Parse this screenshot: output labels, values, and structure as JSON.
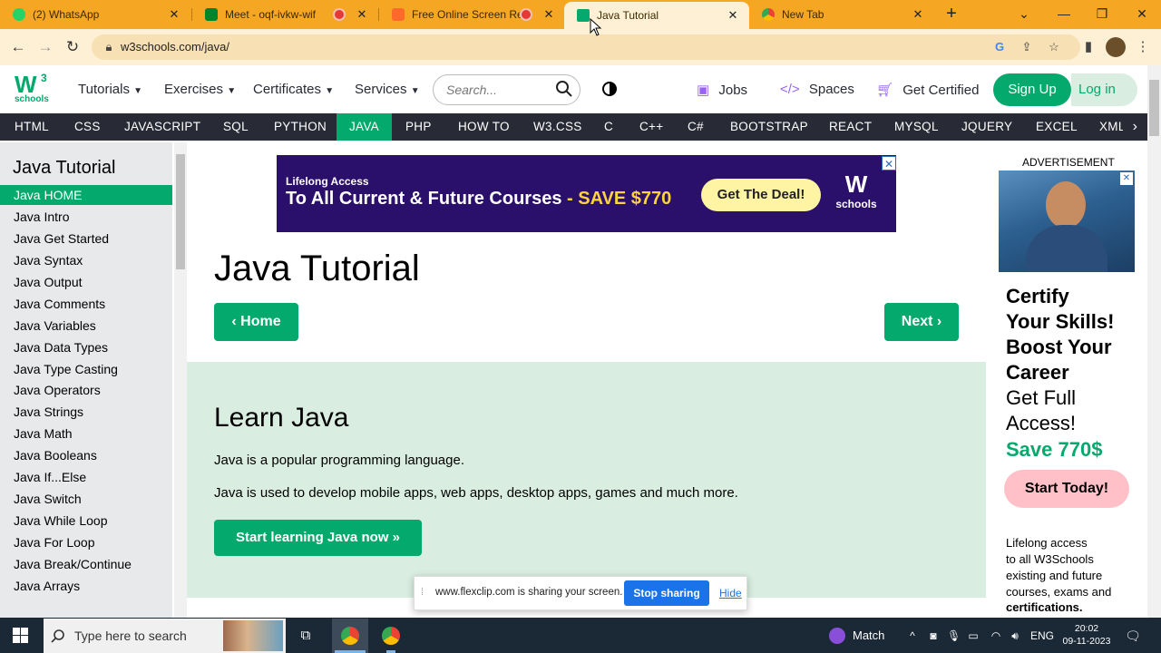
{
  "browser": {
    "tabs": [
      {
        "title": "(2) WhatsApp",
        "icon": "whatsapp-icon"
      },
      {
        "title": "Meet - oqf-ivkw-wif",
        "icon": "meet-icon",
        "recording": true
      },
      {
        "title": "Free Online Screen Reco",
        "icon": "flexclip-icon",
        "recording": true
      },
      {
        "title": "Java Tutorial",
        "icon": "w3schools-icon",
        "active": true
      },
      {
        "title": "New Tab",
        "icon": "chrome-icon"
      }
    ],
    "new_tab": "+",
    "url": "w3schools.com/java/"
  },
  "header": {
    "logo_main": "W",
    "logo_sup": "3",
    "logo_sub": "schools",
    "menus": [
      "Tutorials",
      "Exercises",
      "Certificates",
      "Services"
    ],
    "search_placeholder": "Search...",
    "links": [
      "Jobs",
      "Spaces",
      "Get Certified"
    ],
    "signup": "Sign Up",
    "login": "Log in"
  },
  "topnav": {
    "items": [
      "HTML",
      "CSS",
      "JAVASCRIPT",
      "SQL",
      "PYTHON",
      "JAVA",
      "PHP",
      "HOW TO",
      "W3.CSS",
      "C",
      "C++",
      "C#",
      "BOOTSTRAP",
      "REACT",
      "MYSQL",
      "JQUERY",
      "EXCEL",
      "XML"
    ],
    "active": "JAVA"
  },
  "sidebar": {
    "title": "Java Tutorial",
    "items": [
      "Java HOME",
      "Java Intro",
      "Java Get Started",
      "Java Syntax",
      "Java Output",
      "Java Comments",
      "Java Variables",
      "Java Data Types",
      "Java Type Casting",
      "Java Operators",
      "Java Strings",
      "Java Math",
      "Java Booleans",
      "Java If...Else",
      "Java Switch",
      "Java While Loop",
      "Java For Loop",
      "Java Break/Continue",
      "Java Arrays"
    ],
    "active": "Java HOME"
  },
  "banner": {
    "line1": "Lifelong Access",
    "line2": "To All Current & Future Courses",
    "save": "- SAVE $770",
    "cta": "Get The Deal!",
    "logo_sub": "schools"
  },
  "main": {
    "title": "Java Tutorial",
    "home_btn": "Home",
    "next_btn": "Next",
    "learn_title": "Learn Java",
    "p1": "Java is a popular programming language.",
    "p2": "Java is used to develop mobile apps, web apps, desktop apps, games and much more.",
    "start_btn": "Start learning Java now »"
  },
  "right_ad": {
    "label": "ADVERTISEMENT",
    "lines": [
      "Certify",
      "Your Skills!",
      "Boost Your",
      "Career"
    ],
    "lines2": [
      "Get Full",
      "Access!"
    ],
    "save": "Save 770$",
    "cta": "Start Today!",
    "small": [
      "Lifelong access",
      "to all W3Schools",
      "existing and future",
      "courses, exams and",
      "certifications."
    ]
  },
  "share_bar": {
    "text": "www.flexclip.com is sharing your screen.",
    "stop": "Stop sharing",
    "hide": "Hide"
  },
  "taskbar": {
    "search": "Type here to search",
    "weather": "Match",
    "lang": "ENG",
    "time": "20:02",
    "date": "09-11-2023"
  },
  "colors": {
    "accent": "#04aa6d",
    "tabstrip": "#f5a623",
    "topnav": "#282a35",
    "banner": "#2a0f6b"
  }
}
